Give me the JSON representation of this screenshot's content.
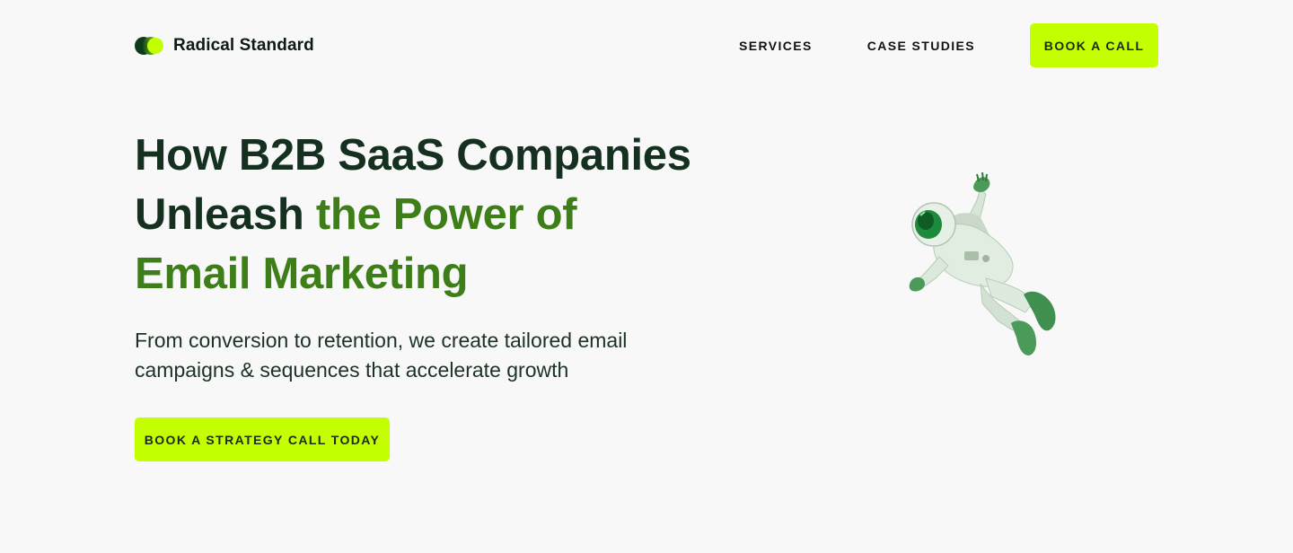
{
  "brand": {
    "name": "Radical Standard",
    "logo_icon": "radical-standard-logo-icon",
    "colors": {
      "dark": "#0d3b1a",
      "lime": "#c3ff00"
    }
  },
  "nav": {
    "services_label": "SERVICES",
    "case_studies_label": "CASE STUDIES",
    "book_call_label": "BOOK A CALL"
  },
  "hero": {
    "title_line1": "How B2B SaaS Companies",
    "title_line2_start": "Unleash ",
    "title_line2_accent": "the Power of",
    "title_line3_accent": "Email Marketing",
    "subtitle": "From conversion to retention, we create tailored email campaigns & sequences that accelerate growth",
    "cta_label": "BOOK A STRATEGY CALL TODAY",
    "illustration": "floating-astronaut-illustration"
  },
  "theme": {
    "background": "#f8f8f8",
    "heading": "#15301f",
    "accent_green": "#3e7e18",
    "button_lime": "#c3ff00"
  }
}
